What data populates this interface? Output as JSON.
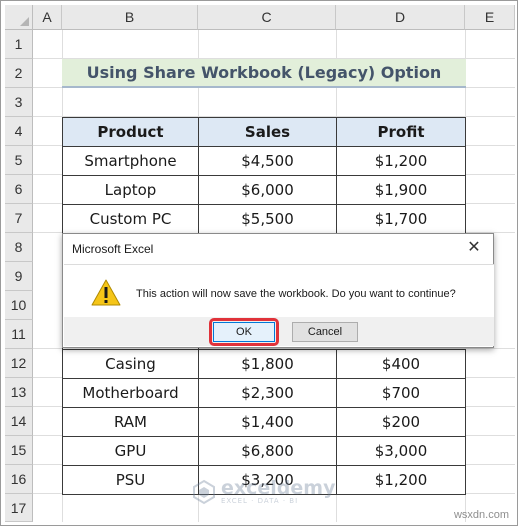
{
  "columns": [
    "A",
    "B",
    "C",
    "D",
    "E"
  ],
  "rows": [
    "1",
    "2",
    "3",
    "4",
    "5",
    "6",
    "7",
    "8",
    "9",
    "10",
    "11",
    "12",
    "13",
    "14",
    "15",
    "16",
    "17"
  ],
  "title": "Using Share Workbook (Legacy) Option",
  "table": {
    "headers": [
      "Product",
      "Sales",
      "Profit"
    ],
    "rows_above": [
      [
        "Smartphone",
        "$4,500",
        "$1,200"
      ],
      [
        "Laptop",
        "$6,000",
        "$1,900"
      ],
      [
        "Custom PC",
        "$5,500",
        "$1,700"
      ]
    ],
    "rows_below": [
      [
        "Casing",
        "$1,800",
        "$400"
      ],
      [
        "Motherboard",
        "$2,300",
        "$700"
      ],
      [
        "RAM",
        "$1,400",
        "$200"
      ],
      [
        "GPU",
        "$6,800",
        "$3,000"
      ],
      [
        "PSU",
        "$3,200",
        "$1,200"
      ]
    ]
  },
  "dialog": {
    "title": "Microsoft Excel",
    "message": "This action will now save the workbook. Do you want to continue?",
    "ok_label": "OK",
    "cancel_label": "Cancel",
    "close_glyph": "✕",
    "icon": "warning-icon",
    "highlight_color": "#e0323a"
  },
  "watermark": {
    "name": "exceldemy",
    "tagline": "EXCEL · DATA · BI",
    "site": "wsxdn.com"
  },
  "colors": {
    "title_fill": "#e2efda",
    "title_text": "#44546a",
    "header_fill": "#dde8f4"
  }
}
